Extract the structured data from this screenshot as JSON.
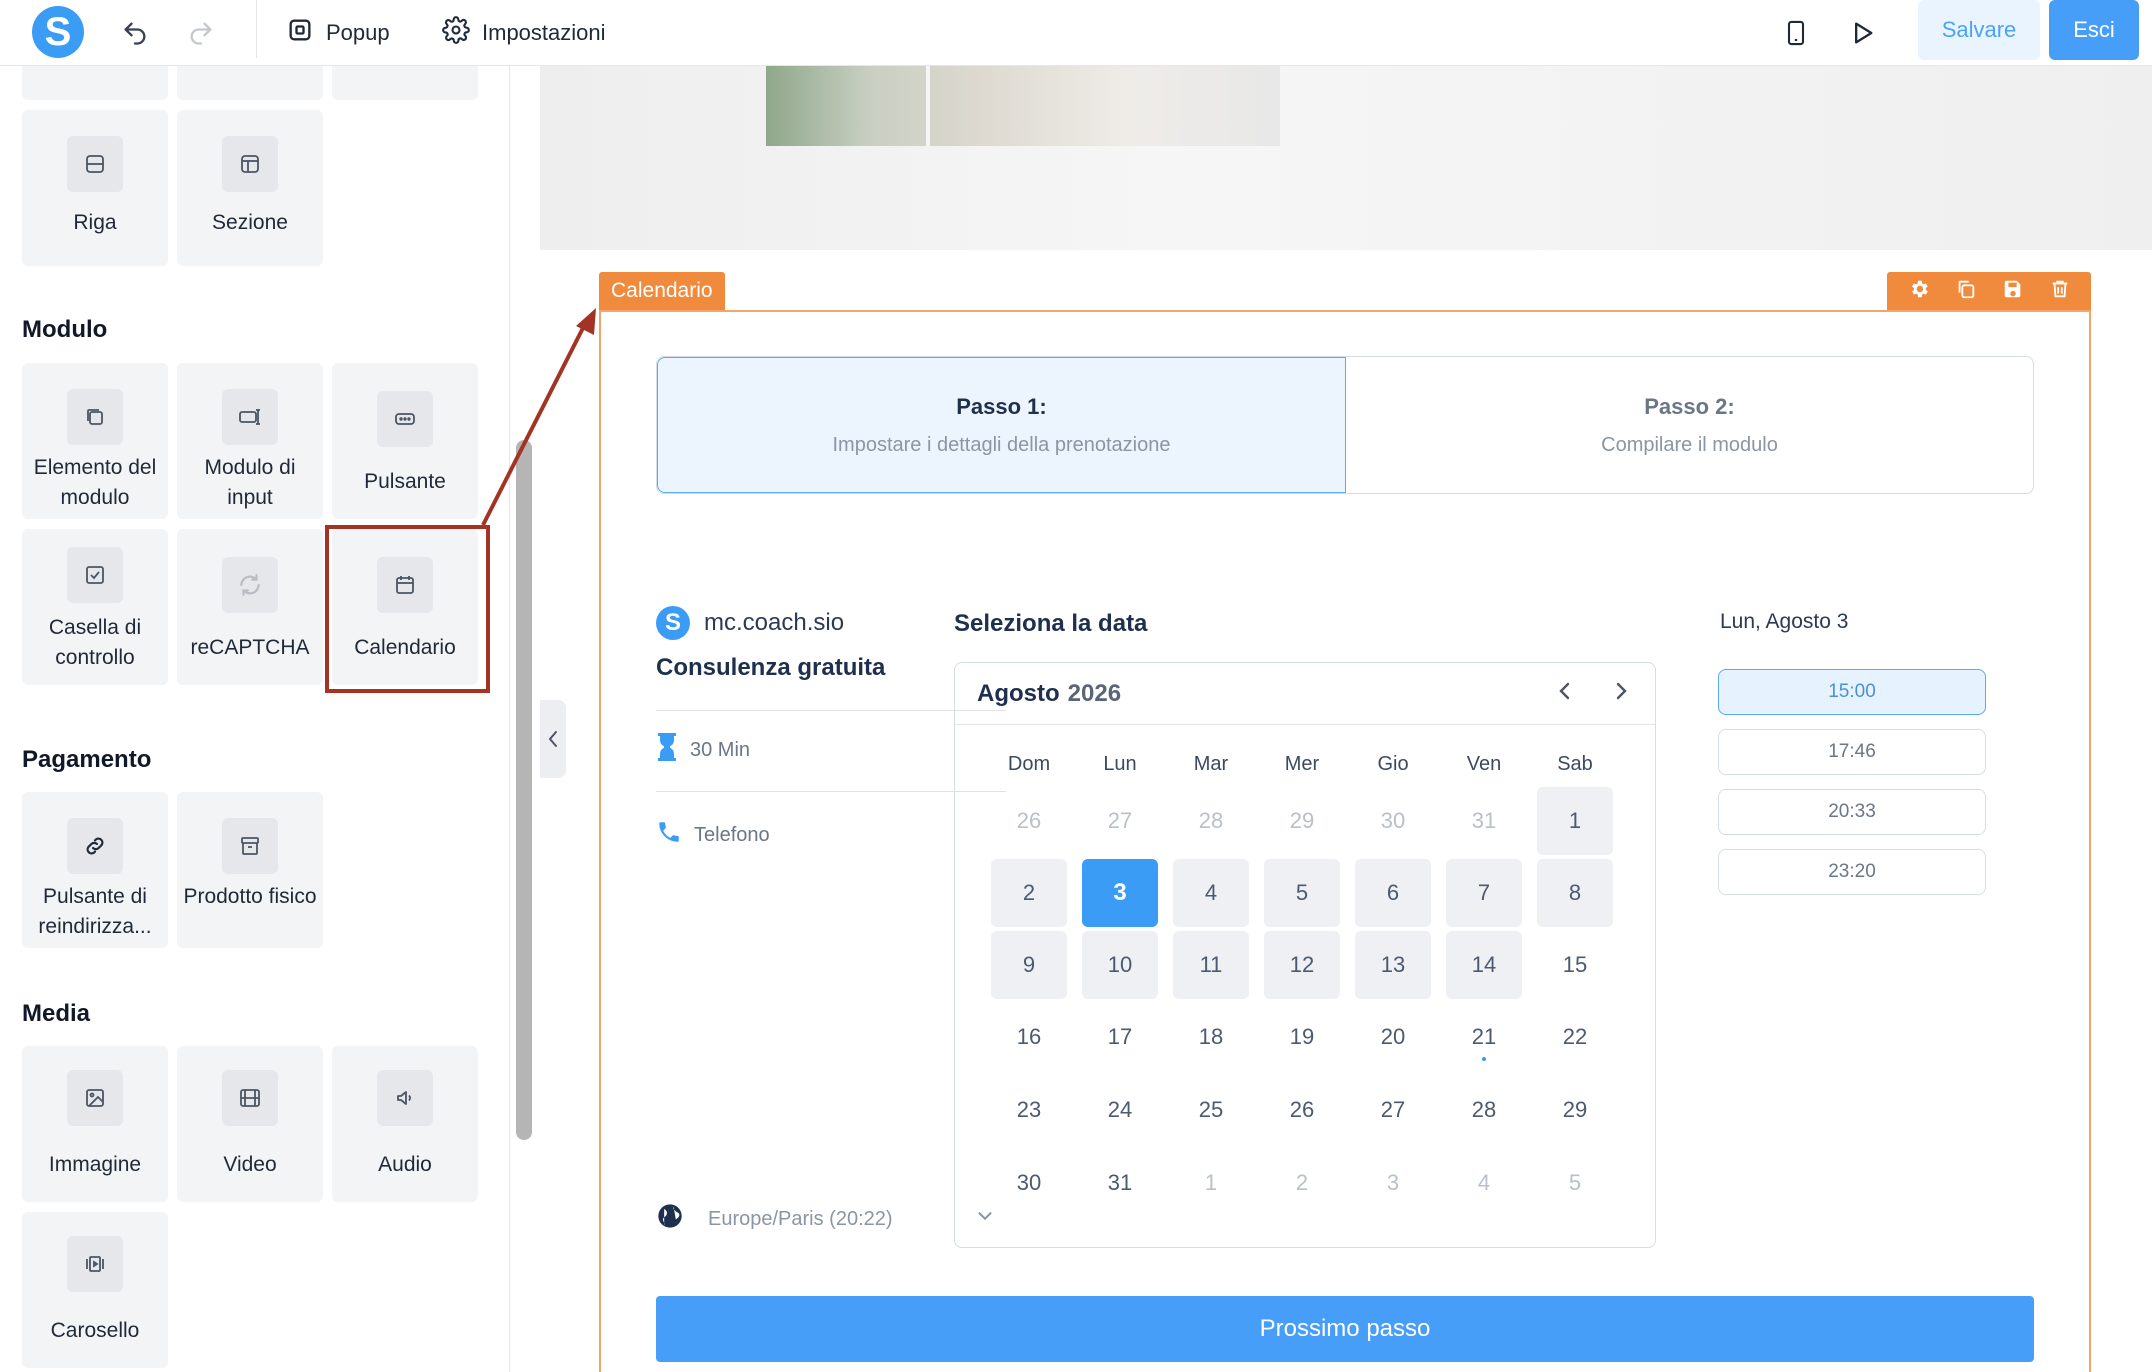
{
  "topbar": {
    "logo_letter": "S",
    "popup_label": "Popup",
    "settings_label": "Impostazioni",
    "save_label": "Salvare",
    "exit_label": "Esci"
  },
  "sidebar": {
    "top_tiles": [
      {
        "label": "Riga",
        "icon": "row-icon"
      },
      {
        "label": "Sezione",
        "icon": "section-icon"
      }
    ],
    "sections": [
      {
        "title": "Modulo"
      },
      {
        "title": "Pagamento"
      },
      {
        "title": "Media"
      }
    ],
    "modulo_tiles": [
      {
        "label": "Elemento del modulo",
        "icon": "form-element-icon"
      },
      {
        "label": "Modulo di input",
        "icon": "input-icon"
      },
      {
        "label": "Pulsante",
        "icon": "button-icon"
      },
      {
        "label": "Casella di controllo",
        "icon": "checkbox-icon"
      },
      {
        "label": "reCAPTCHA",
        "icon": "recaptcha-icon"
      },
      {
        "label": "Calendario",
        "icon": "calendar-icon"
      }
    ],
    "pagamento_tiles": [
      {
        "label": "Pulsante di reindirizza...",
        "icon": "link-icon"
      },
      {
        "label": "Prodotto fisico",
        "icon": "box-icon"
      }
    ],
    "media_tiles": [
      {
        "label": "Immagine",
        "icon": "image-icon"
      },
      {
        "label": "Video",
        "icon": "video-icon"
      },
      {
        "label": "Audio",
        "icon": "audio-icon"
      },
      {
        "label": "Carosello",
        "icon": "carousel-icon"
      }
    ]
  },
  "canvas": {
    "element_tag": "Calendario",
    "steps": [
      {
        "title": "Passo 1:",
        "subtitle": "Impostare i dettagli della prenotazione"
      },
      {
        "title": "Passo 2:",
        "subtitle": "Compilare il modulo"
      }
    ],
    "org_name": "mc.coach.sio",
    "service_title": "Consulenza gratuita",
    "duration": "30 Min",
    "channel": "Telefono",
    "timezone": "Europe/Paris (20:22)",
    "select_date_title": "Seleziona la data",
    "month": "Agosto",
    "year": "2026",
    "weekdays": [
      "Dom",
      "Lun",
      "Mar",
      "Mer",
      "Gio",
      "Ven",
      "Sab"
    ],
    "days": [
      {
        "n": "26",
        "state": "muted"
      },
      {
        "n": "27",
        "state": "muted"
      },
      {
        "n": "28",
        "state": "muted"
      },
      {
        "n": "29",
        "state": "muted"
      },
      {
        "n": "30",
        "state": "muted"
      },
      {
        "n": "31",
        "state": "muted"
      },
      {
        "n": "1",
        "state": "avail"
      },
      {
        "n": "2",
        "state": "avail"
      },
      {
        "n": "3",
        "state": "selected"
      },
      {
        "n": "4",
        "state": "avail"
      },
      {
        "n": "5",
        "state": "avail"
      },
      {
        "n": "6",
        "state": "avail"
      },
      {
        "n": "7",
        "state": "avail"
      },
      {
        "n": "8",
        "state": "avail"
      },
      {
        "n": "9",
        "state": "avail"
      },
      {
        "n": "10",
        "state": "avail"
      },
      {
        "n": "11",
        "state": "avail"
      },
      {
        "n": "12",
        "state": "avail"
      },
      {
        "n": "13",
        "state": "avail"
      },
      {
        "n": "14",
        "state": "avail"
      },
      {
        "n": "15",
        "state": "plain"
      },
      {
        "n": "16",
        "state": "plain"
      },
      {
        "n": "17",
        "state": "plain"
      },
      {
        "n": "18",
        "state": "plain"
      },
      {
        "n": "19",
        "state": "plain"
      },
      {
        "n": "20",
        "state": "plain"
      },
      {
        "n": "21",
        "state": "today"
      },
      {
        "n": "22",
        "state": "plain"
      },
      {
        "n": "23",
        "state": "plain"
      },
      {
        "n": "24",
        "state": "plain"
      },
      {
        "n": "25",
        "state": "plain"
      },
      {
        "n": "26",
        "state": "plain"
      },
      {
        "n": "27",
        "state": "plain"
      },
      {
        "n": "28",
        "state": "plain"
      },
      {
        "n": "29",
        "state": "plain"
      },
      {
        "n": "30",
        "state": "plain"
      },
      {
        "n": "31",
        "state": "plain"
      },
      {
        "n": "1",
        "state": "muted"
      },
      {
        "n": "2",
        "state": "muted"
      },
      {
        "n": "3",
        "state": "muted"
      },
      {
        "n": "4",
        "state": "muted"
      },
      {
        "n": "5",
        "state": "muted"
      }
    ],
    "selected_date_label": "Lun, Agosto 3",
    "slots": [
      {
        "time": "15:00",
        "active": true
      },
      {
        "time": "17:46",
        "active": false
      },
      {
        "time": "20:33",
        "active": false
      },
      {
        "time": "23:20",
        "active": false
      }
    ],
    "next_button": "Prossimo passo"
  },
  "colors": {
    "primary": "#479ef8",
    "accent_orange": "#f08a3c",
    "annotation_red": "#a33424"
  }
}
